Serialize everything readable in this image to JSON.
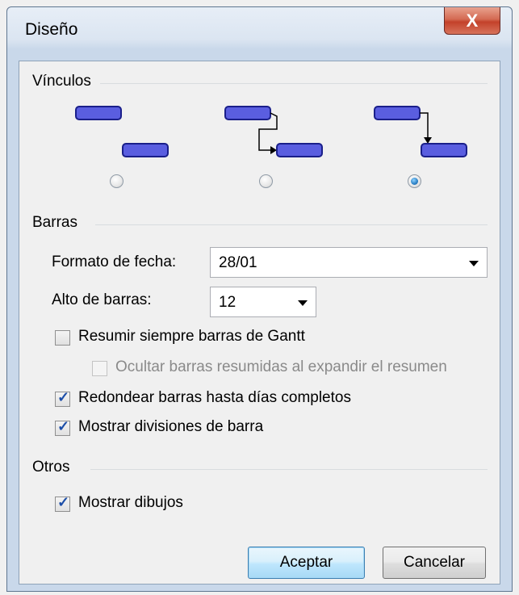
{
  "window": {
    "title": "Diseño",
    "close_label": "X"
  },
  "links": {
    "group_label": "Vínculos",
    "options": [
      {
        "name": "no-connector",
        "selected": false
      },
      {
        "name": "elbow-connector-side",
        "selected": false
      },
      {
        "name": "elbow-connector-top",
        "selected": true
      }
    ]
  },
  "bars": {
    "group_label": "Barras",
    "date_format_label": "Formato de fecha:",
    "date_format_value": "28/01",
    "bar_height_label": "Alto de barras:",
    "bar_height_value": "12",
    "summarize_label": "Resumir siempre barras de Gantt",
    "summarize_checked": false,
    "hide_summary_label": "Ocultar barras resumidas al expandir el resumen",
    "hide_summary_checked": false,
    "round_label": "Redondear barras hasta días completos",
    "round_checked": true,
    "splits_label": "Mostrar divisiones de barra",
    "splits_checked": true
  },
  "other": {
    "group_label": "Otros",
    "drawings_label": "Mostrar dibujos",
    "drawings_checked": true
  },
  "buttons": {
    "ok": "Aceptar",
    "cancel": "Cancelar"
  },
  "colors": {
    "bar_fill": "#5a5ee0",
    "bar_border": "#1a1f8a",
    "connector": "#000000"
  },
  "check_mark": "✓"
}
